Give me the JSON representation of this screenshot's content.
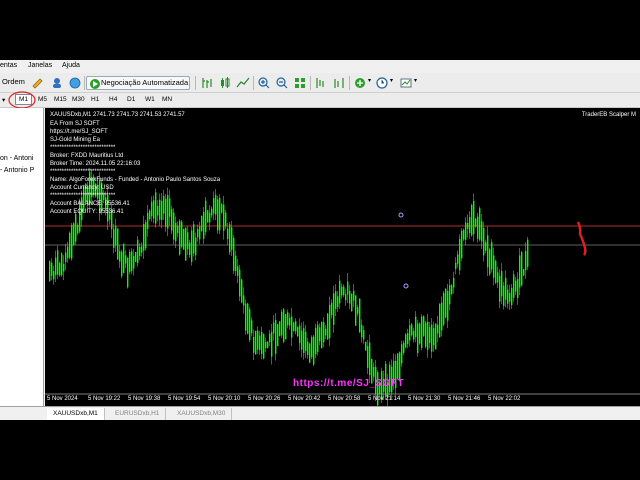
{
  "menu": {
    "items": [
      "entas",
      "Janelas",
      "Ajuda"
    ]
  },
  "toolbar": {
    "order_label": "Ordem",
    "algo_label": "Negociação Automatizada"
  },
  "periods": [
    "M1",
    "M5",
    "M15",
    "M30",
    "H1",
    "H4",
    "D1",
    "W1",
    "MN"
  ],
  "left_panel": {
    "items": [
      "on - Antoni",
      "- Antonio P"
    ]
  },
  "chart": {
    "symbol_line": "XAUUSDxb,M1  2741.73 2741.73 2741.53 2741.57",
    "expert_name": "TraderEB Scalper M",
    "info_lines": [
      "EA From SJ SOFT",
      "https://t.me/SJ_SOFT",
      "SJ-Gold Mining Ea",
      "****************************",
      "Broker: FXDD Mauritius Ltd",
      "Broker Time: 2024.11.05 22:16:03",
      "****************************",
      "Name: AlgoForexFunds - Funded - Antonio Paulo Santos Souza",
      "Account Currency: USD",
      "****************************",
      "Account BALANCE: 95536.41",
      "Account EQUITY: 95536.41"
    ],
    "x_ticks": [
      "5 Nov 2024",
      "5 Nov 19:22",
      "5 Nov 19:38",
      "5 Nov 19:54",
      "5 Nov 20:10",
      "5 Nov 20:26",
      "5 Nov 20:42",
      "5 Nov 20:58",
      "5 Nov 21:14",
      "5 Nov 21:30",
      "5 Nov 21:46",
      "5 Nov 22:02"
    ],
    "watermark": "https://t.me/SJ_SOFT",
    "colors": {
      "candles": "#00ff00",
      "background": "#000000",
      "level_line": "#b03030",
      "bid_line": "#c0c0c0"
    }
  },
  "tabs": [
    "XAUUSDxb,M1",
    "EURUSDxb,H1",
    "XAUUSDxb,M30"
  ],
  "active_tab": "XAUUSDxb,M1",
  "active_period": "M1"
}
